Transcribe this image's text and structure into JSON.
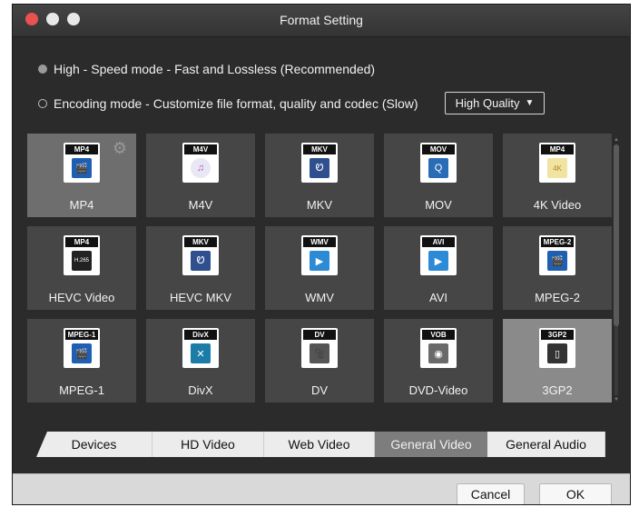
{
  "window": {
    "title": "Format Setting"
  },
  "modes": {
    "speed_label": "High - Speed mode - Fast and Lossless (Recommended)",
    "encoding_label": "Encoding mode - Customize file format, quality and codec (Slow)",
    "quality_value": "High Quality",
    "quality_arrow": "▼"
  },
  "formats": [
    {
      "tag": "MP4",
      "label": "MP4",
      "icon": "clapperboard-icon",
      "color": "#1f5fb3"
    },
    {
      "tag": "M4V",
      "label": "M4V",
      "icon": "music-note-icon",
      "color": "#e8e8f4"
    },
    {
      "tag": "MKV",
      "label": "MKV",
      "icon": "matroska-icon",
      "color": "#2f4f8f"
    },
    {
      "tag": "MOV",
      "label": "MOV",
      "icon": "quicktime-icon",
      "color": "#2a6db5"
    },
    {
      "tag": "MP4",
      "label": "4K Video",
      "icon": "4k-badge-icon",
      "color": "#f1e3a2"
    },
    {
      "tag": "MP4",
      "label": "HEVC Video",
      "icon": "hevc-badge-icon",
      "color": "#222222"
    },
    {
      "tag": "MKV",
      "label": "HEVC MKV",
      "icon": "matroska-icon",
      "color": "#2f4f8f"
    },
    {
      "tag": "WMV",
      "label": "WMV",
      "icon": "media-player-icon",
      "color": "#2c8ad6"
    },
    {
      "tag": "AVI",
      "label": "AVI",
      "icon": "media-player-icon",
      "color": "#2c8ad6"
    },
    {
      "tag": "MPEG-2",
      "label": "MPEG-2",
      "icon": "clapperboard-icon",
      "color": "#1f5fb3"
    },
    {
      "tag": "MPEG-1",
      "label": "MPEG-1",
      "icon": "clapperboard-icon",
      "color": "#1f5fb3"
    },
    {
      "tag": "DivX",
      "label": "DivX",
      "icon": "divx-icon",
      "color": "#1c7ca8"
    },
    {
      "tag": "DV",
      "label": "DV",
      "icon": "camcorder-icon",
      "color": "#555555"
    },
    {
      "tag": "VOB",
      "label": "DVD-Video",
      "icon": "dvd-icon",
      "color": "#6a6a6a"
    },
    {
      "tag": "3GP2",
      "label": "3GP2",
      "icon": "phone-icon",
      "color": "#333333"
    }
  ],
  "tabs": [
    "Devices",
    "HD Video",
    "Web Video",
    "General Video",
    "General Audio"
  ],
  "buttons": {
    "cancel": "Cancel",
    "ok": "OK"
  }
}
